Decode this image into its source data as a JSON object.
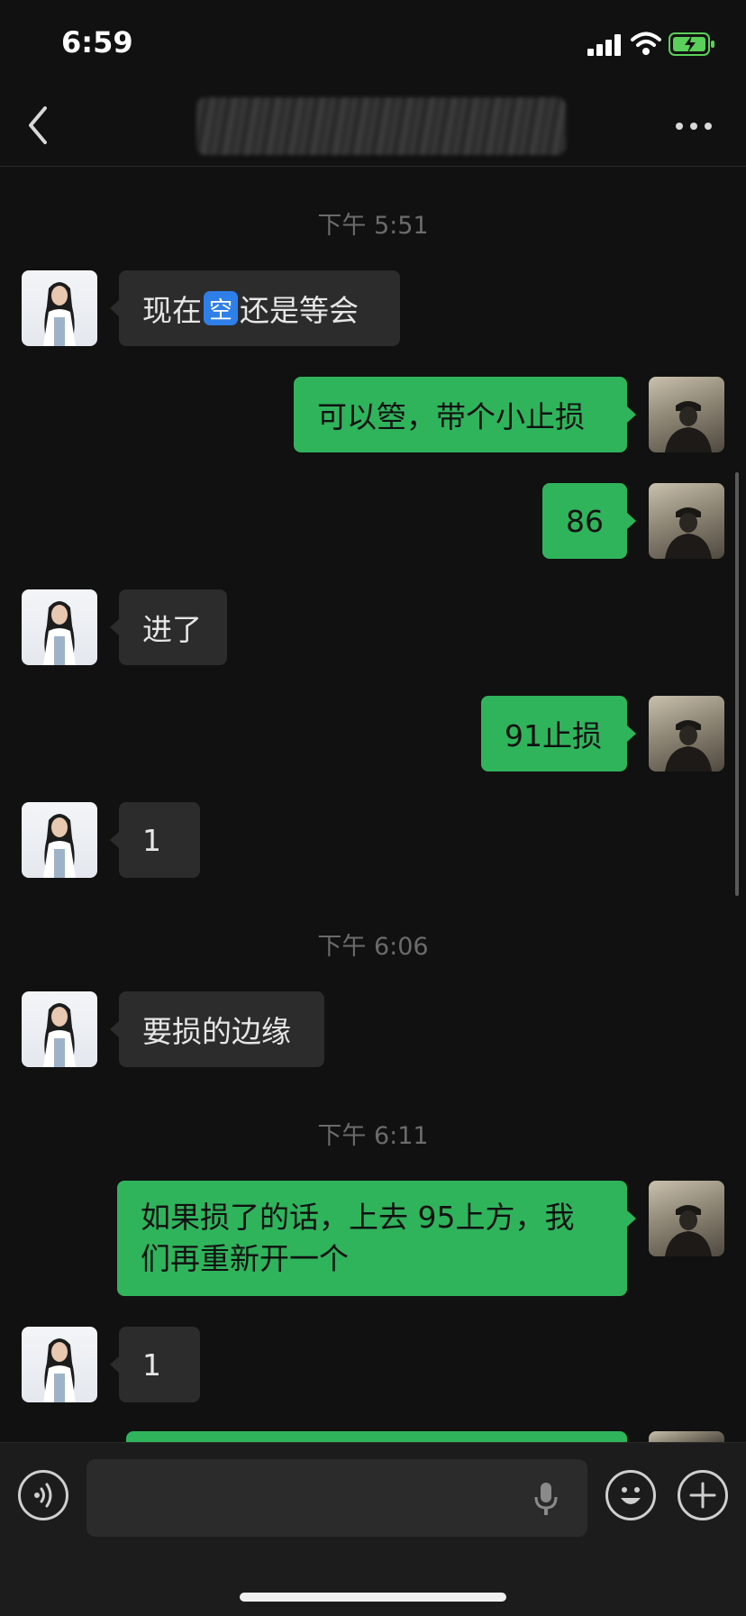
{
  "status_bar": {
    "time": "6:59"
  },
  "chat": {
    "time_1": "下午 5:51",
    "time_2": "下午 6:06",
    "time_3": "下午 6:11",
    "msg_1_pre": "现在",
    "msg_1_emoji": "空",
    "msg_1_post": "还是等会",
    "msg_2": "可以箜，带个小止损",
    "msg_3": "86",
    "msg_4": "进了",
    "msg_5": "91止损",
    "msg_6": "1",
    "msg_7": "要损的边缘",
    "msg_8": "如果损了的话，上去 95上方，我们再重新开一个",
    "msg_9": "1"
  },
  "colors": {
    "outgoing_bubble": "#2fb45c",
    "incoming_bubble": "#2c2c2c",
    "background": "#111111"
  },
  "icons": [
    "back-icon",
    "more-icon",
    "voice-icon",
    "mic-icon",
    "emoji-icon",
    "plus-icon",
    "signal-icon",
    "wifi-icon",
    "battery-icon"
  ]
}
